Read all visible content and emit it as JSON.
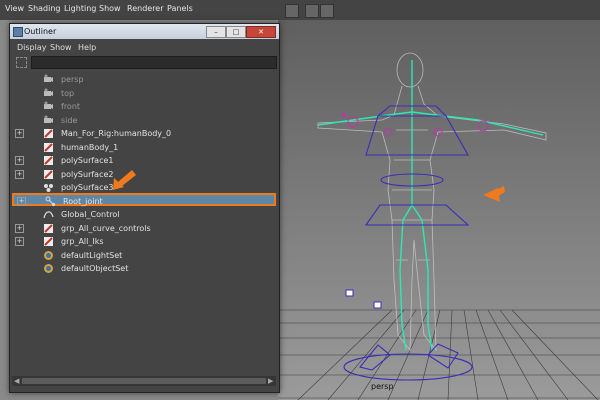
{
  "menubar": [
    "View",
    "Shading",
    "Lighting",
    "Show",
    "Renderer",
    "Panels"
  ],
  "outliner": {
    "title": "Outliner",
    "menu": [
      "Display",
      "Show",
      "Help"
    ],
    "window_buttons": {
      "minimize": "–",
      "maximize": "□",
      "close": "✕"
    },
    "items": [
      {
        "label": "persp",
        "icon": "camera-icon",
        "expandable": false,
        "dimmed": true,
        "selected": false
      },
      {
        "label": "top",
        "icon": "camera-icon",
        "expandable": false,
        "dimmed": true,
        "selected": false
      },
      {
        "label": "front",
        "icon": "camera-icon",
        "expandable": false,
        "dimmed": true,
        "selected": false
      },
      {
        "label": "side",
        "icon": "camera-icon",
        "expandable": false,
        "dimmed": true,
        "selected": false
      },
      {
        "label": "Man_For_Rig:humanBody_0",
        "icon": "mesh-icon",
        "expandable": true,
        "dimmed": false,
        "selected": false
      },
      {
        "label": "humanBody_1",
        "icon": "mesh-icon",
        "expandable": false,
        "dimmed": false,
        "selected": false
      },
      {
        "label": "polySurface1",
        "icon": "mesh-icon",
        "expandable": true,
        "dimmed": false,
        "selected": false
      },
      {
        "label": "polySurface2",
        "icon": "mesh-icon",
        "expandable": true,
        "dimmed": false,
        "selected": false
      },
      {
        "label": "polySurface3",
        "icon": "group-icon",
        "expandable": false,
        "dimmed": false,
        "selected": false
      },
      {
        "label": "Root_joint",
        "icon": "joint-icon",
        "expandable": true,
        "dimmed": false,
        "selected": true
      },
      {
        "label": "Global_Control",
        "icon": "curve-icon",
        "expandable": false,
        "dimmed": false,
        "selected": false
      },
      {
        "label": "grp_All_curve_controls",
        "icon": "mesh-icon",
        "expandable": true,
        "dimmed": false,
        "selected": false
      },
      {
        "label": "grp_All_Iks",
        "icon": "mesh-icon",
        "expandable": true,
        "dimmed": false,
        "selected": false
      },
      {
        "label": "defaultLightSet",
        "icon": "set-icon",
        "expandable": false,
        "dimmed": false,
        "selected": false
      },
      {
        "label": "defaultObjectSet",
        "icon": "set-icon",
        "expandable": false,
        "dimmed": false,
        "selected": false
      }
    ]
  },
  "viewport": {
    "camera_label": "persp"
  },
  "colors": {
    "accent": "#f07b1c",
    "selection": "#5e86a6",
    "rig": "#2ee8b0",
    "control": "#3a2db8",
    "joint": "#c72fb0"
  }
}
